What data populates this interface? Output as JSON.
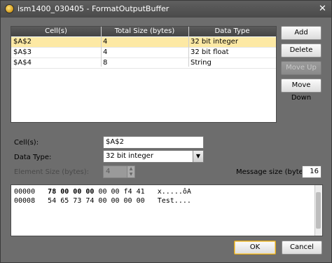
{
  "window": {
    "title": "ism1400_030405 - FormatOutputBuffer"
  },
  "grid": {
    "columns": [
      "Cell(s)",
      "Total Size (bytes)",
      "Data Type"
    ],
    "rows": [
      [
        "$A$2",
        "4",
        "32 bit integer"
      ],
      [
        "$A$3",
        "4",
        "32 bit float"
      ],
      [
        "$A$4",
        "8",
        "String"
      ]
    ],
    "selected_index": 0
  },
  "buttons": {
    "add": "Add",
    "delete": "Delete",
    "move_up": "Move Up",
    "move_down": "Move Down",
    "ok": "OK",
    "cancel": "Cancel"
  },
  "form": {
    "cells_label": "Cell(s):",
    "cells_value": "$A$2",
    "data_type_label": "Data Type:",
    "data_type_value": "32 bit integer",
    "element_size_label": "Element Size (bytes):",
    "element_size_value": "4",
    "message_size_label": "Message size (bytes):",
    "message_size_value": "16"
  },
  "hexdump": {
    "lines": [
      {
        "offset": "00000",
        "bold_bytes": "78 00 00 00",
        "bytes": "00 00 f4 41",
        "ascii": "x.....ôA"
      },
      {
        "offset": "00008",
        "bold_bytes": "",
        "bytes": "54 65 73 74 00 00 00 00",
        "ascii": "Test...."
      }
    ]
  },
  "colors": {
    "selection": "#fde9a4",
    "dialog_bg": "#6d6d6d",
    "header_bg": "#4f4f4f"
  },
  "icons": {
    "app": "app-orb-icon",
    "close": "close-icon",
    "dropdown": "chevron-down-icon"
  }
}
